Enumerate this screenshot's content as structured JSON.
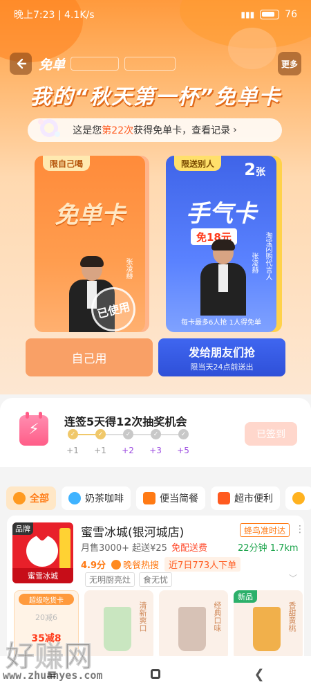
{
  "status_bar": {
    "time_speed": "晚上7:23 | 4.1K/s",
    "battery": "76"
  },
  "nav": {
    "title": "免单",
    "more": "更多"
  },
  "hero": {
    "title": "我的“秋天第一杯”免单卡",
    "record_prefix": "这是您",
    "record_count": "第22次",
    "record_suffix": "获得免单卡，查看记录",
    "record_arrow": "›"
  },
  "cards": {
    "self": {
      "tag": "限自己喝",
      "name": "免单卡",
      "stamp": "已使用",
      "ambassador_name": "张凌赫"
    },
    "gift": {
      "tag": "限送别人",
      "count": "2",
      "count_unit": "张",
      "name": "手气卡",
      "amount": "免18元",
      "ambassador_name": "张凌赫",
      "ambassador_title": "淘宝闪购代言人",
      "footer": "每卡最多6人抢 1人得免单"
    }
  },
  "buttons": {
    "self_use": "自己用",
    "send_title": "发给朋友们抢",
    "send_sub": "限当天24点前送出"
  },
  "checkin": {
    "title": "连签5天得12次抽奖机会",
    "steps": [
      {
        "label": "+1",
        "done": true
      },
      {
        "label": "+1",
        "done": true
      },
      {
        "label": "+2",
        "done": false
      },
      {
        "label": "+3",
        "done": false
      },
      {
        "label": "+5",
        "done": false
      }
    ],
    "button": "已签到"
  },
  "categories": [
    "全部",
    "奶茶咖啡",
    "便当简餐",
    "超市便利"
  ],
  "shop": {
    "badge": "品牌",
    "logo_text": "蜜雪冰城",
    "name": "蜜雪冰城(银河城店)",
    "delivery_tag": "蜂鸟准时达",
    "sales": "月售3000+",
    "min_order": "起送¥25",
    "free_delivery": "免配送费",
    "eta": "22分钟",
    "distance": "1.7km",
    "rating": "4.9分",
    "hot_label": "晚餐热搜",
    "recent": "近7日773人下单",
    "chips": [
      "无明厨亮灶",
      "食无忧"
    ],
    "coupon": {
      "tag": "超级吃货卡",
      "cond": "20减6",
      "value": "35减8"
    },
    "thumbs": [
      {
        "label": "清新爽口",
        "new": ""
      },
      {
        "label": "经典口味",
        "new": ""
      },
      {
        "label": "香甜黄桃",
        "new": "新品"
      }
    ]
  },
  "watermark": {
    "brand": "好赚网",
    "url": "www.zhuanyes.com"
  }
}
